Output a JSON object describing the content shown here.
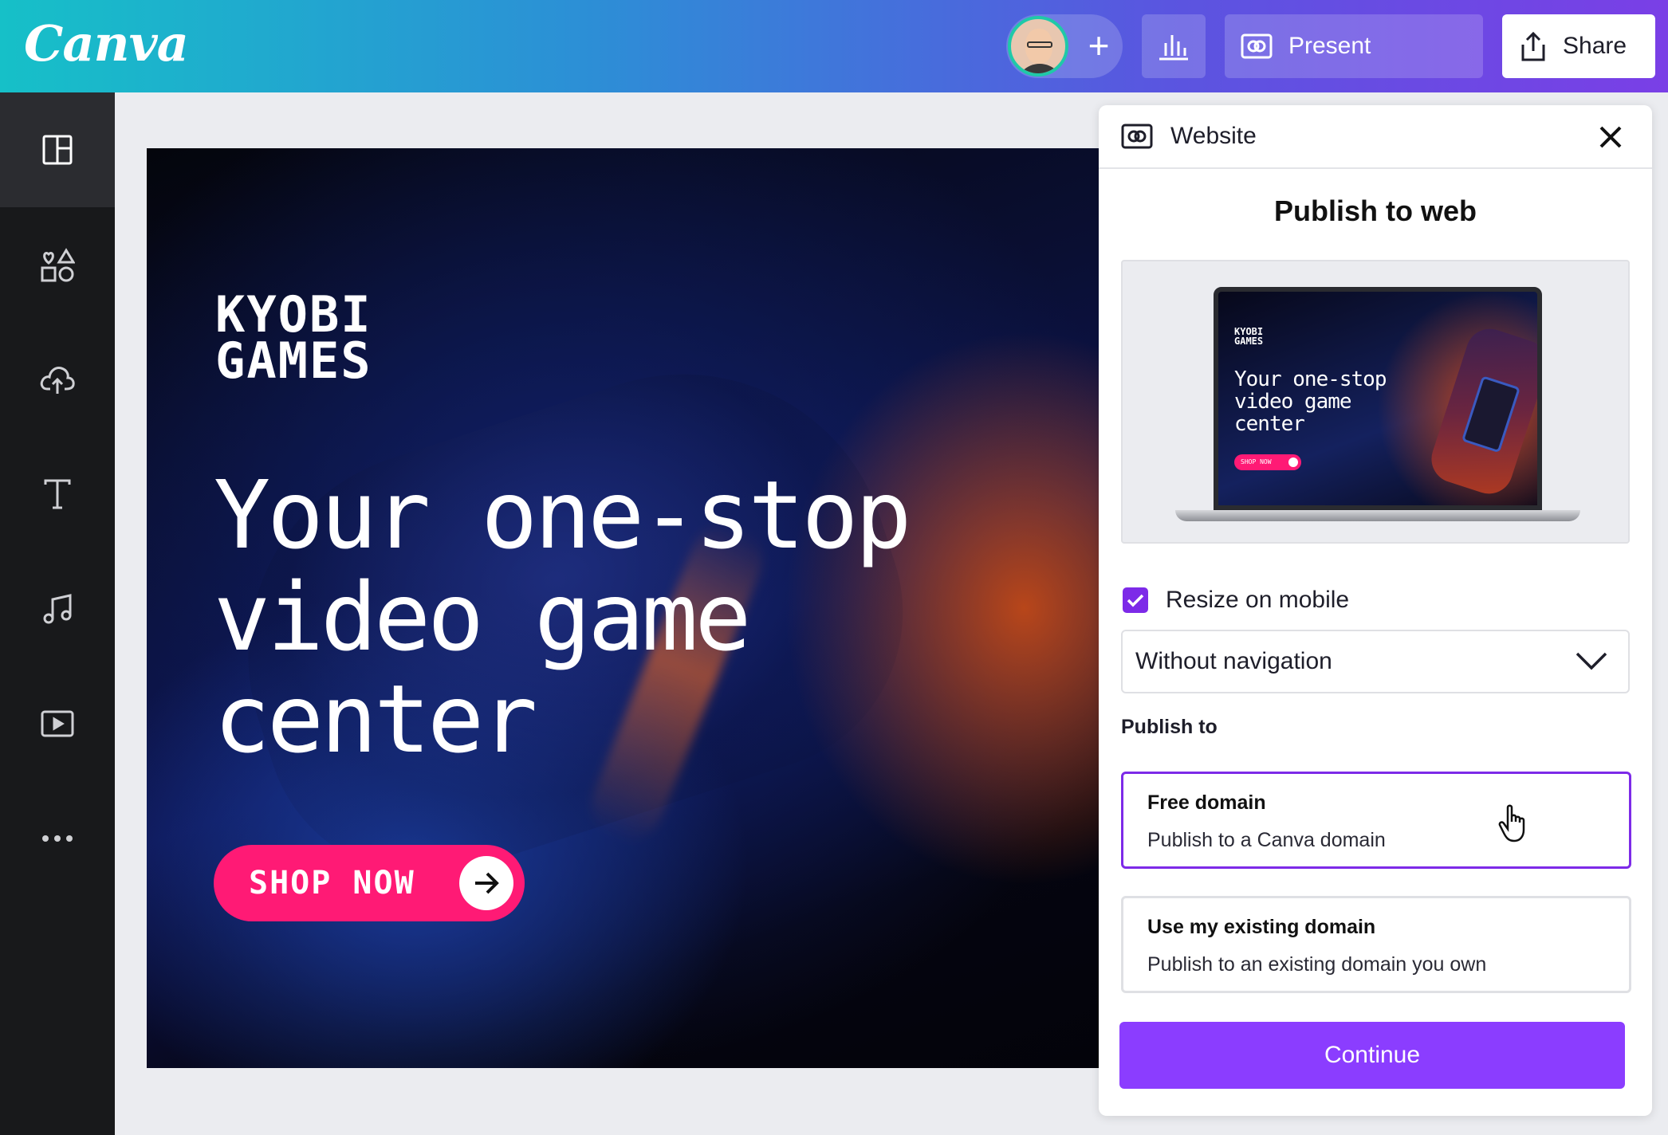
{
  "app": {
    "logo": "Canva"
  },
  "toolbar": {
    "present_label": "Present",
    "share_label": "Share"
  },
  "sidebar": {
    "items": [
      {
        "icon": "layout-icon",
        "active": true
      },
      {
        "icon": "elements-icon"
      },
      {
        "icon": "upload-icon"
      },
      {
        "icon": "text-icon"
      },
      {
        "icon": "music-icon"
      },
      {
        "icon": "video-icon"
      },
      {
        "icon": "more-icon"
      }
    ]
  },
  "canvas": {
    "brand_line1": "KYOBI",
    "brand_line2": "GAMES",
    "headline_line1": "Your one-stop",
    "headline_line2": "video game",
    "headline_line3": "center",
    "cta": "SHOP NOW"
  },
  "panel": {
    "header": "Website",
    "title": "Publish to web",
    "preview": {
      "brand_line1": "KYOBI",
      "brand_line2": "GAMES",
      "headline": "Your one-stop video game center",
      "cta": "SHOP NOW"
    },
    "resize_label": "Resize on mobile",
    "resize_checked": true,
    "navigation_select": "Without navigation",
    "publish_to_label": "Publish to",
    "options": [
      {
        "title": "Free domain",
        "desc": "Publish to a Canva domain",
        "selected": true
      },
      {
        "title": "Use my existing domain",
        "desc": "Publish to an existing domain you own",
        "selected": false
      }
    ],
    "continue_label": "Continue"
  },
  "colors": {
    "accent": "#8b3dff",
    "selected_border": "#7d2ae8",
    "cta_pink": "#ff1a75",
    "sidebar_bg": "#18191b"
  }
}
